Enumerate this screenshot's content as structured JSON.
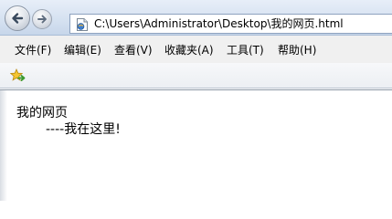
{
  "navigation": {
    "back_icon": "back-arrow-icon",
    "forward_icon": "forward-arrow-icon"
  },
  "address_bar": {
    "page_icon": "html-page-icon",
    "url": "C:\\Users\\Administrator\\Desktop\\我的网页.html"
  },
  "menu": {
    "items": [
      {
        "label": "文件(F)"
      },
      {
        "label": "编辑(E)"
      },
      {
        "label": "查看(V)"
      },
      {
        "label": "收藏夹(A)"
      },
      {
        "label": "工具(T)"
      },
      {
        "label": "帮助(H)"
      }
    ]
  },
  "favorites_bar": {
    "icon": "add-favorite-star-icon"
  },
  "page_content": {
    "heading": "我的网页",
    "line2": "----我在这里!"
  },
  "colors": {
    "nav_gradient_top": "#e7eef8",
    "nav_gradient_bottom": "#c7d6ea",
    "menubar_bg": "#f0f0f0",
    "arrow_blue": "#2a63b8"
  }
}
